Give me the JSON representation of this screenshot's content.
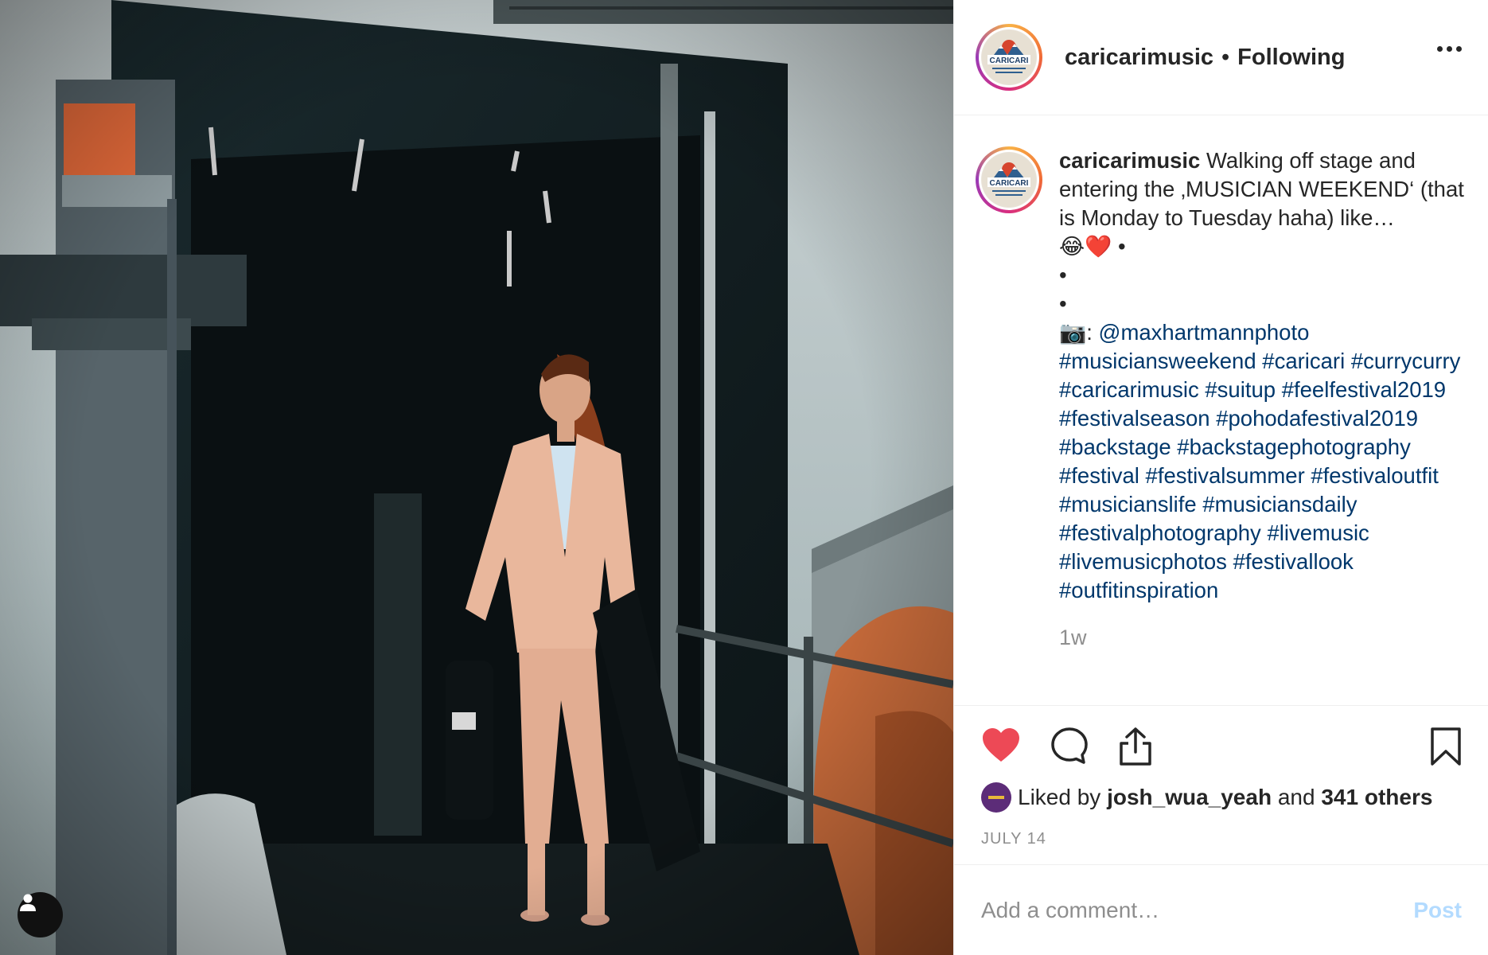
{
  "post": {
    "image_alt": "Woman in a pink suit walking off a festival stage carrying a guitar case",
    "user_tag_icon": "person-icon"
  },
  "header": {
    "username": "caricarimusic",
    "separator": "•",
    "follow_status": "Following",
    "more_icon": "more-horizontal-icon"
  },
  "caption": {
    "username": "caricarimusic",
    "text_line1": "Walking off stage and entering the ‚MUSICIAN WEEKEND‘ (that is Monday to Tuesday haha) like…",
    "emojis": "😂❤️",
    "bullet": "•",
    "camera_emoji": "📷",
    "colon": ":",
    "mention": "@maxhartmannphoto",
    "hashtags": [
      "#musiciansweekend",
      "#caricari",
      "#currycurry",
      "#caricarimusic",
      "#suitup",
      "#feelfestival2019",
      "#festivalseason",
      "#pohodafestival2019",
      "#backstage",
      "#backstagephotography",
      "#festival",
      "#festivalsummer",
      "#festivaloutfit",
      "#musicianslife",
      "#musiciansdaily",
      "#festivalphotography",
      "#livemusic",
      "#livemusicphotos",
      "#festivallook",
      "#outfitinspiration"
    ],
    "time_ago": "1w"
  },
  "actions": {
    "like_icon": "heart-filled-icon",
    "comment_icon": "comment-icon",
    "share_icon": "share-icon",
    "save_icon": "bookmark-icon",
    "liked_prefix": "Liked by",
    "liked_user": "josh_wua_yeah",
    "liked_and": "and",
    "liked_others": "341 others",
    "date": "JULY 14",
    "like_color": "#ed4956"
  },
  "comment": {
    "placeholder": "Add a comment…",
    "post_label": "Post"
  },
  "logo": {
    "text": "CARICARI"
  }
}
